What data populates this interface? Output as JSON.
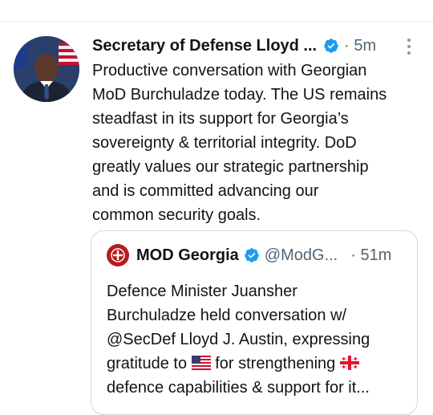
{
  "tweet": {
    "author": "Secretary of Defense Lloyd ...",
    "time": "· 5m",
    "text_lines": [
      "Productive conversation with Georgian",
      "MoD Burchuladze today. The US remains",
      "steadfast in its support for Georgia’s",
      "sovereignty & territorial integrity. DoD",
      "greatly values our strategic partnership",
      "and is committed advancing our",
      "common security goals."
    ]
  },
  "quoted_tweet": {
    "author": "MOD Georgia",
    "handle": "@ModG...",
    "time": "· 51m",
    "line1": "Defence Minister Juansher",
    "line2": "Burchuladze held conversation w/",
    "line3": "@SecDef Lloyd J. Austin, expressing",
    "line4a": "gratitude to",
    "line4b": "for strengthening",
    "line5": "defence capabilities & support for it..."
  },
  "icons": {
    "verified": "verified-badge-icon",
    "more": "more-options-icon",
    "us_flag": "us-flag-emoji",
    "georgia_flag": "georgia-flag-emoji"
  },
  "colors": {
    "verified_blue": "#1d9bf0",
    "secondary_text": "#536471",
    "border": "#cfd9de"
  }
}
